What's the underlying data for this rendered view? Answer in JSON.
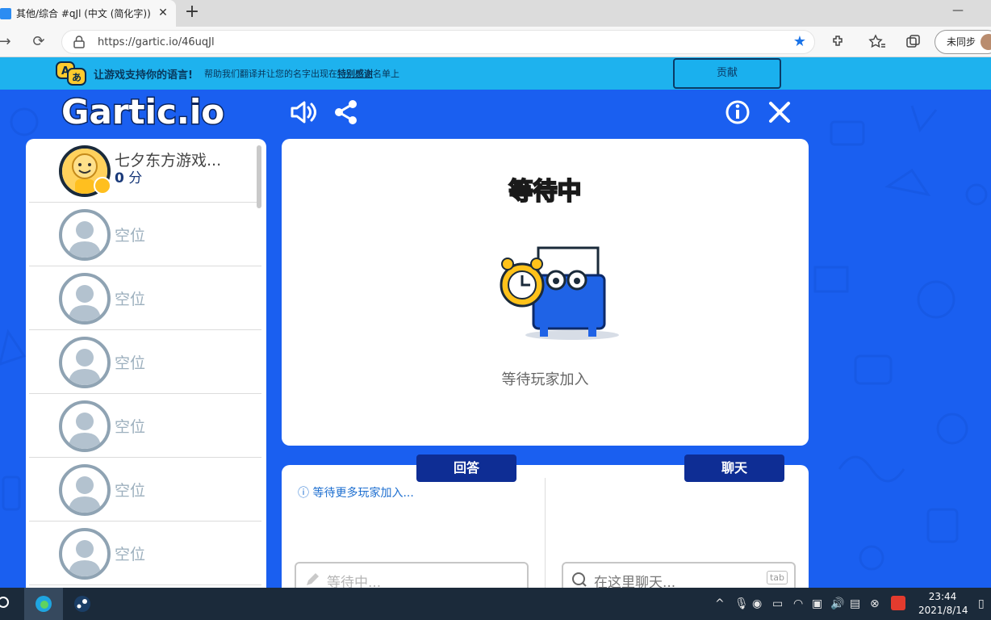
{
  "browser": {
    "tab_title": "其他/综合 #qJl (中文 (简化字)) - G",
    "url": "https://gartic.io/46uqJl",
    "sync_label": "未同步"
  },
  "banner": {
    "bold_text": "让游戏支持你的语言!",
    "sub_prefix": "帮助我们翻译并让您的名字出现在",
    "sub_link": "特别感谢",
    "sub_suffix": "名单上",
    "contribute_label": "贡献"
  },
  "game": {
    "logo_text": "Gartic.io",
    "board_title": "等待中",
    "board_subtitle": "等待玩家加入",
    "answer_tab": "回答",
    "chat_tab": "聊天",
    "answer_info": "等待更多玩家加入...",
    "answer_placeholder": "等待中...",
    "chat_placeholder": "在这里聊天...",
    "tab_key": "tab"
  },
  "players": [
    {
      "name": "七夕东方游戏...",
      "score": "0",
      "unit": "分",
      "empty": false
    },
    {
      "name": "空位",
      "empty": true
    },
    {
      "name": "空位",
      "empty": true
    },
    {
      "name": "空位",
      "empty": true
    },
    {
      "name": "空位",
      "empty": true
    },
    {
      "name": "空位",
      "empty": true
    },
    {
      "name": "空位",
      "empty": true
    }
  ],
  "taskbar": {
    "time": "23:44",
    "date": "2021/8/14"
  },
  "colors": {
    "game_bg": "#1a5ff0",
    "banner_bg": "#1eb2ee",
    "tab_navy": "#0e2d94",
    "title_yellow": "#ffc21a",
    "avatar_grey": "#8fa3b3"
  }
}
